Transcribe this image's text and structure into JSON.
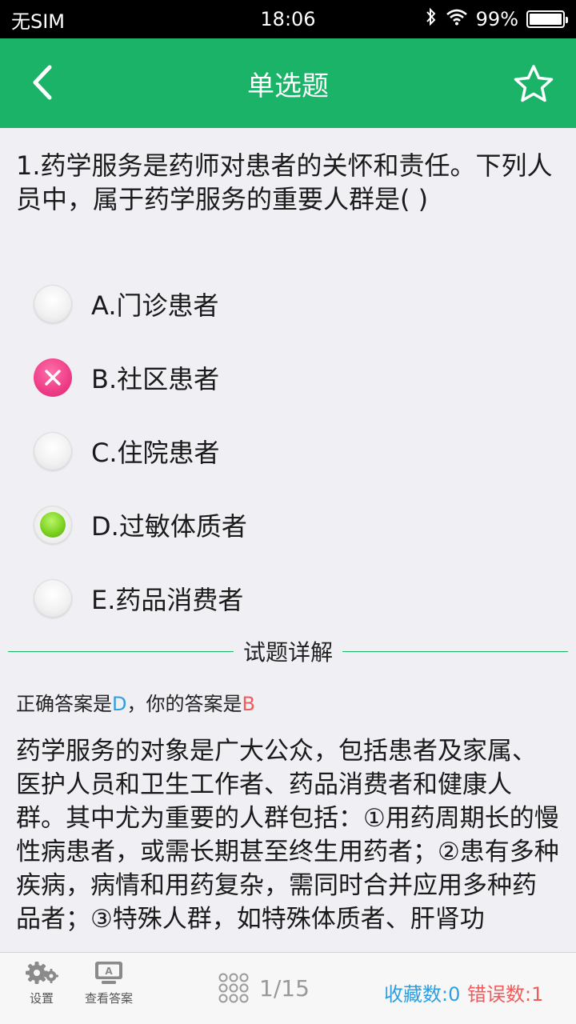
{
  "status": {
    "carrier": "无SIM",
    "time": "18:06",
    "battery": "99%",
    "battery_level": 0.99
  },
  "nav": {
    "title": "单选题",
    "back_icon": "chevron-left-icon",
    "star_icon": "star-outline-icon"
  },
  "question": {
    "text": "1.药学服务是药师对患者的关怀和责任。下列人员中，属于药学服务的重要人群是( )"
  },
  "options": [
    {
      "label": "A.门诊患者",
      "state": "unselected"
    },
    {
      "label": "B.社区患者",
      "state": "wrong"
    },
    {
      "label": "C.住院患者",
      "state": "unselected"
    },
    {
      "label": "D.过敏体质者",
      "state": "correct"
    },
    {
      "label": "E.药品消费者",
      "state": "unselected"
    }
  ],
  "detail": {
    "heading": "试题详解",
    "answer_prefix": "正确答案是",
    "correct_answer": "D",
    "answer_mid": "，你的答案是",
    "user_answer": "B",
    "explanation": "药学服务的对象是广大公众，包括患者及家属、医护人员和卫生工作者、药品消费者和健康人群。其中尤为重要的人群包括：①用药周期长的慢性病患者，或需长期甚至终生用药者；②患有多种疾病，病情和用药复杂，需同时合并应用多种药品者；③特殊人群，如特殊体质者、肝肾功"
  },
  "bottom": {
    "settings_label": "设置",
    "view_answer_label": "查看答案",
    "page": "1/15",
    "favorites": "收藏数:0",
    "errors": "错误数:1"
  },
  "colors": {
    "accent": "#1bb368",
    "correct_blue": "#2d9fe0",
    "wrong_red": "#f05b5b",
    "wrong_pink": "#ee3d86",
    "correct_green": "#7ed321"
  }
}
